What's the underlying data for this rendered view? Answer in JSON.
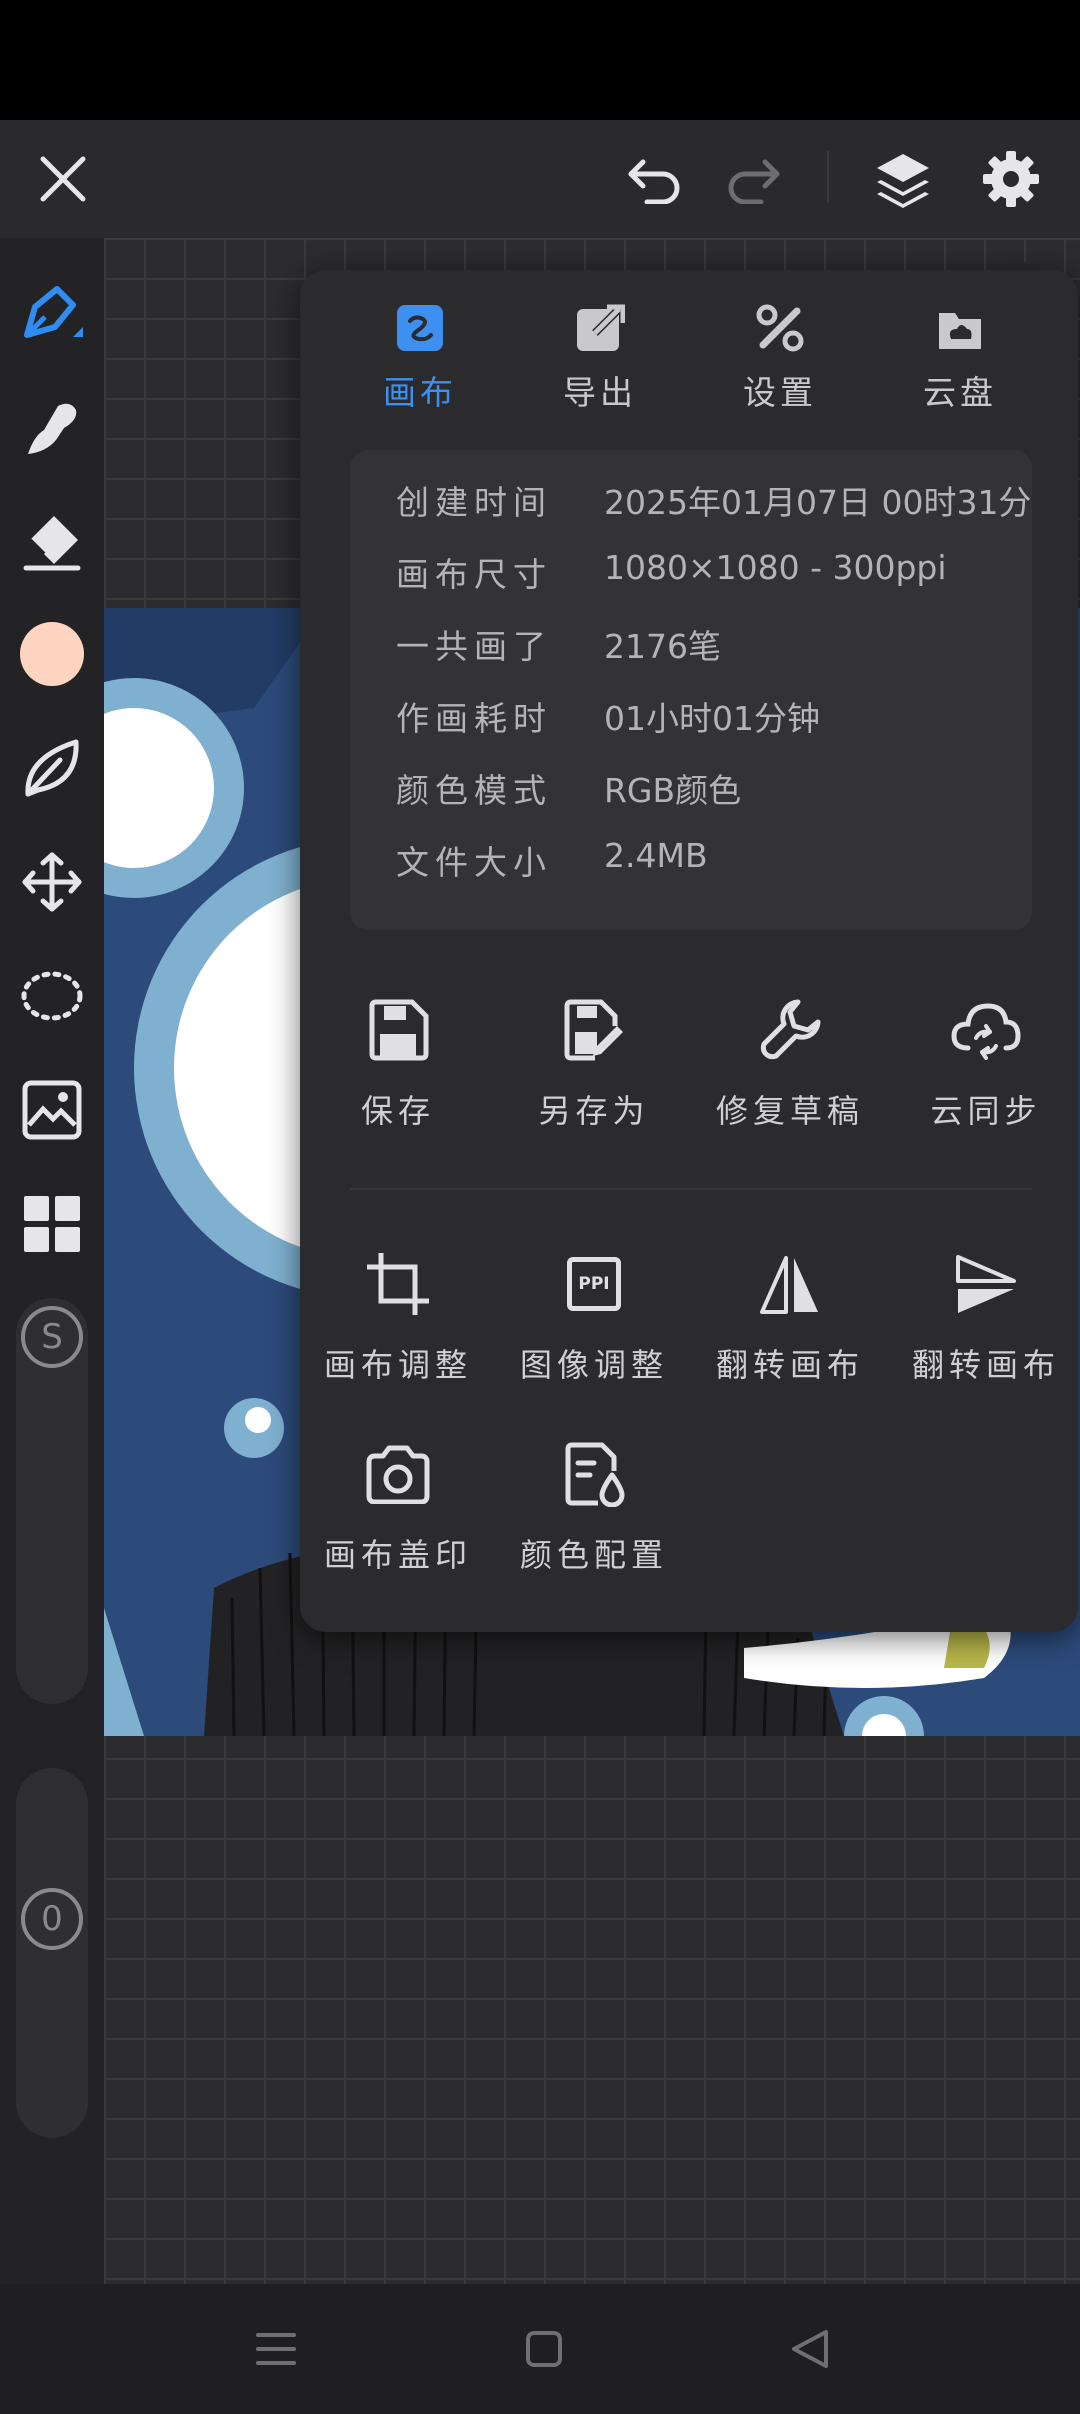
{
  "panel": {
    "tabs": [
      {
        "label": "画布",
        "icon": "canvas-icon",
        "active": true
      },
      {
        "label": "导出",
        "icon": "export-icon"
      },
      {
        "label": "设置",
        "icon": "settings-tools-icon"
      },
      {
        "label": "云盘",
        "icon": "cloud-drive-icon"
      }
    ],
    "info": [
      {
        "key": "创建时间",
        "value": "2025年01月07日 00时31分"
      },
      {
        "key": "画布尺寸",
        "value": "1080×1080 - 300ppi"
      },
      {
        "key": "一共画了",
        "value": "2176笔"
      },
      {
        "key": "作画耗时",
        "value": "01小时01分钟"
      },
      {
        "key": "颜色模式",
        "value": "RGB颜色"
      },
      {
        "key": "文件大小",
        "value": "2.4MB"
      }
    ],
    "actions": [
      {
        "label": "保存",
        "icon": "save-icon"
      },
      {
        "label": "另存为",
        "icon": "save-as-icon"
      },
      {
        "label": "修复草稿",
        "icon": "wrench-icon"
      },
      {
        "label": "云同步",
        "icon": "cloud-sync-icon"
      },
      {
        "label": "画布调整",
        "icon": "crop-icon"
      },
      {
        "label": "图像调整",
        "icon": "ppi-icon"
      },
      {
        "label": "翻转画布",
        "icon": "flip-horizontal-icon"
      },
      {
        "label": "翻转画布",
        "icon": "flip-vertical-icon"
      },
      {
        "label": "画布盖印",
        "icon": "camera-icon"
      },
      {
        "label": "颜色配置",
        "icon": "color-config-icon"
      }
    ],
    "ppi_glyph": "PPI"
  },
  "sidebar": {
    "brush_size_glyph": "S",
    "opacity_glyph": "0"
  },
  "colors": {
    "accent": "#3d8ff2",
    "current_color": "#ffd5c2",
    "artwork_blue": "#2c4a7a",
    "artwork_light_blue": "#7fb0cf"
  }
}
